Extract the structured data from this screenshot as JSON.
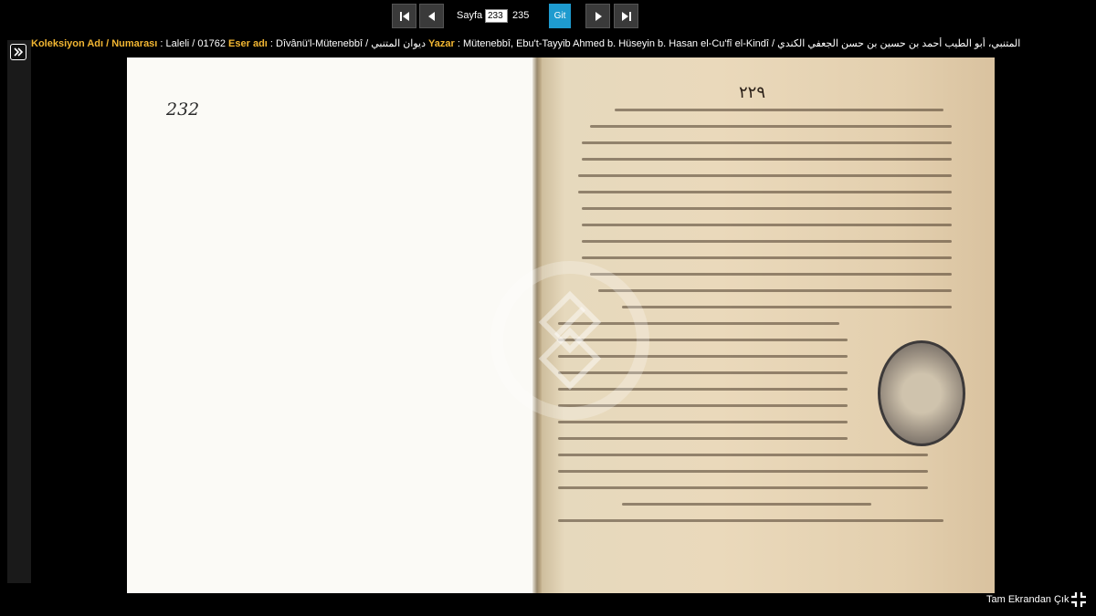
{
  "nav": {
    "first_icon": "first-page-icon",
    "prev_icon": "previous-page-icon",
    "next_icon": "next-page-icon",
    "last_icon": "last-page-icon",
    "sayfa_label": "Sayfa",
    "page_value": "233",
    "page_total": "235",
    "git_label": "Git",
    "git_color": "#1e9bcf"
  },
  "info": {
    "collection_key": "Koleksiyon Adı / Numarası",
    "collection_value": ": Laleli / 01762",
    "work_key": "Eser adı",
    "work_value": ": Dîvânü'l-Mütenebbî / ديوان المتنبي",
    "author_key": "Yazar",
    "author_value": ": Mütenebbî, Ebu't-Tayyib Ahmed b. Hüseyin b. Hasan el-Cu'fî el-Kindî / المتنبي، أبو الطيب أحمد بن حسين بن حسن الجعفي الكندي",
    "key_color": "#f2b632"
  },
  "side": {
    "expand_icon": "expand-panel-icon"
  },
  "manuscript": {
    "folio_left": "232",
    "folio_right": "٢٢٩",
    "seal_icon": "library-seal-icon",
    "watermark_icon": "watermark-logo-icon"
  },
  "footer": {
    "fullscreen_label": "Tam Ekrandan Çık",
    "fullscreen_icon": "exit-fullscreen-icon"
  }
}
